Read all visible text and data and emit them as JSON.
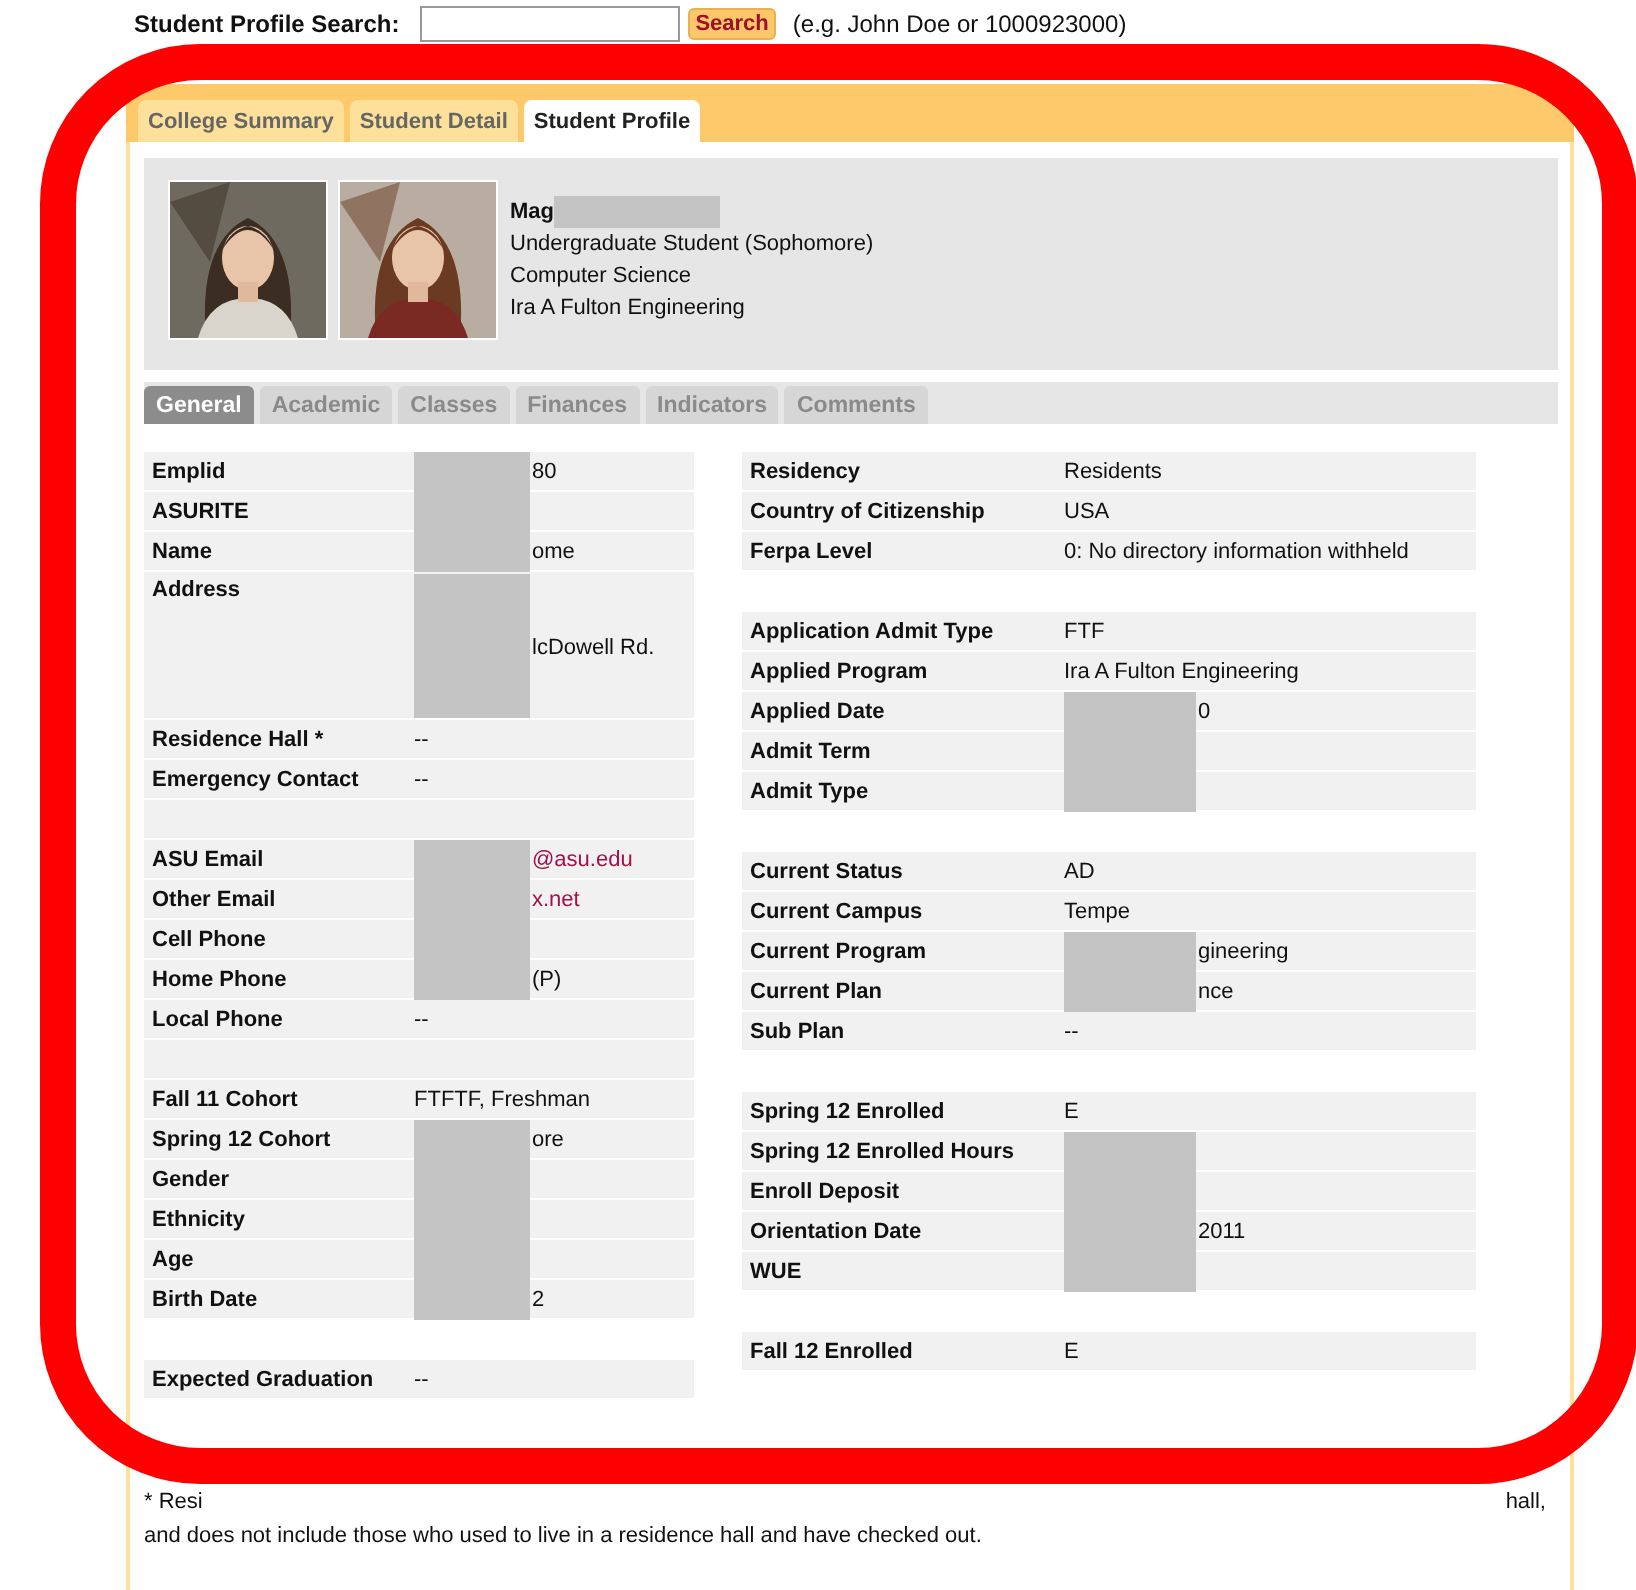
{
  "search": {
    "label": "Student Profile Search:",
    "button": "Search",
    "hint": "(e.g. John Doe or 1000923000)"
  },
  "tabs": [
    {
      "label": "College Summary",
      "selected": false
    },
    {
      "label": "Student Detail",
      "selected": false
    },
    {
      "label": "Student Profile",
      "selected": true
    }
  ],
  "profile": {
    "name": "Mag",
    "name_redacted": true,
    "lines": [
      "Undergraduate Student (Sophomore)",
      "Computer Science",
      "Ira A Fulton Engineering"
    ]
  },
  "subtabs": [
    {
      "label": "General",
      "selected": true
    },
    {
      "label": "Academic",
      "selected": false
    },
    {
      "label": "Classes",
      "selected": false
    },
    {
      "label": "Finances",
      "selected": false
    },
    {
      "label": "Indicators",
      "selected": false
    },
    {
      "label": "Comments",
      "selected": false
    }
  ],
  "left_table": [
    {
      "label": "Emplid",
      "value": "80",
      "redacted": true
    },
    {
      "label": "ASURITE",
      "redacted": true
    },
    {
      "label": "Name",
      "value": "ome",
      "redacted": true
    },
    {
      "label": "Address",
      "value": "lcDowell Rd.",
      "redacted": true,
      "kind": "tall"
    },
    {
      "label": "Residence Hall *",
      "value": "--"
    },
    {
      "label": "Emergency Contact",
      "value": "--"
    },
    {
      "kind": "blank"
    },
    {
      "label": "ASU Email",
      "value": "@asu.edu",
      "redacted": true,
      "kind": "link"
    },
    {
      "label": "Other Email",
      "value": "x.net",
      "redacted": true,
      "kind": "link"
    },
    {
      "label": "Cell Phone",
      "redacted": true
    },
    {
      "label": "Home Phone",
      "value": "(P)",
      "redacted": true
    },
    {
      "label": "Local Phone",
      "value": "--"
    },
    {
      "kind": "blank"
    },
    {
      "label": "Fall 11 Cohort",
      "value": "FTFTF, Freshman"
    },
    {
      "label": "Spring 12 Cohort",
      "value": "ore",
      "redacted": true
    },
    {
      "label": "Gender",
      "redacted": true
    },
    {
      "label": "Ethnicity",
      "redacted": true
    },
    {
      "label": "Age",
      "redacted": true
    },
    {
      "label": "Birth Date",
      "value": "2",
      "redacted": true
    },
    {
      "kind": "gap"
    },
    {
      "label": "Expected Graduation",
      "value": "--"
    }
  ],
  "right_table": [
    {
      "label": "Residency",
      "value": "Residents"
    },
    {
      "label": "Country of Citizenship",
      "value": "USA"
    },
    {
      "label": "Ferpa Level",
      "value": "0: No directory information withheld"
    },
    {
      "kind": "gap"
    },
    {
      "label": "Application Admit Type",
      "value": "FTF"
    },
    {
      "label": "Applied Program",
      "value": "Ira A Fulton Engineering"
    },
    {
      "label": "Applied Date",
      "value": "0",
      "redacted": true
    },
    {
      "label": "Admit Term",
      "redacted": true
    },
    {
      "label": "Admit Type",
      "redacted": true
    },
    {
      "kind": "gap"
    },
    {
      "label": "Current Status",
      "value": "AD"
    },
    {
      "label": "Current Campus",
      "value": "Tempe"
    },
    {
      "label": "Current Program",
      "value": "gineering",
      "redacted": true
    },
    {
      "label": "Current Plan",
      "value": "nce",
      "redacted": true
    },
    {
      "label": "Sub Plan",
      "value": "--"
    },
    {
      "kind": "gap"
    },
    {
      "label": "Spring 12 Enrolled",
      "value": "E"
    },
    {
      "label": "Spring 12 Enrolled Hours",
      "redacted": true
    },
    {
      "label": "Enroll Deposit",
      "redacted": true
    },
    {
      "label": "Orientation Date",
      "value": "2011",
      "redacted": true
    },
    {
      "label": "WUE",
      "redacted": true
    },
    {
      "kind": "gap"
    },
    {
      "label": "Fall 12 Enrolled",
      "value": "E"
    }
  ],
  "footnote": {
    "line_1_start": "* Resi",
    "line_1_end": "hall,",
    "line_2": "and does not include those who used to live in a residence hall and have checked out."
  }
}
